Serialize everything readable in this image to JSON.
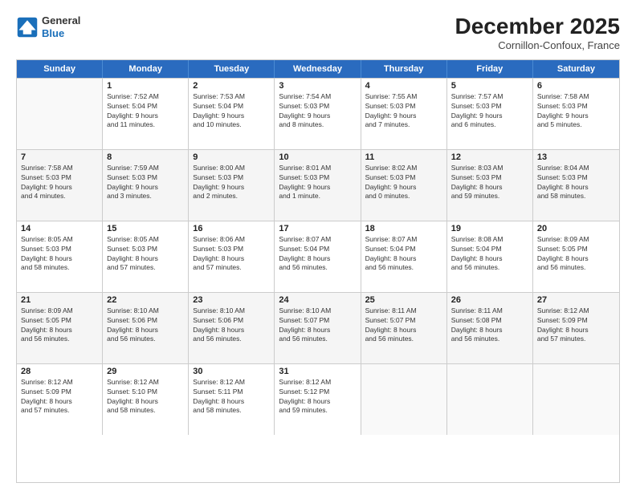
{
  "logo": {
    "line1": "General",
    "line2": "Blue"
  },
  "title": "December 2025",
  "location": "Cornillon-Confoux, France",
  "header_days": [
    "Sunday",
    "Monday",
    "Tuesday",
    "Wednesday",
    "Thursday",
    "Friday",
    "Saturday"
  ],
  "weeks": [
    [
      {
        "day": "",
        "info": ""
      },
      {
        "day": "1",
        "info": "Sunrise: 7:52 AM\nSunset: 5:04 PM\nDaylight: 9 hours\nand 11 minutes."
      },
      {
        "day": "2",
        "info": "Sunrise: 7:53 AM\nSunset: 5:04 PM\nDaylight: 9 hours\nand 10 minutes."
      },
      {
        "day": "3",
        "info": "Sunrise: 7:54 AM\nSunset: 5:03 PM\nDaylight: 9 hours\nand 8 minutes."
      },
      {
        "day": "4",
        "info": "Sunrise: 7:55 AM\nSunset: 5:03 PM\nDaylight: 9 hours\nand 7 minutes."
      },
      {
        "day": "5",
        "info": "Sunrise: 7:57 AM\nSunset: 5:03 PM\nDaylight: 9 hours\nand 6 minutes."
      },
      {
        "day": "6",
        "info": "Sunrise: 7:58 AM\nSunset: 5:03 PM\nDaylight: 9 hours\nand 5 minutes."
      }
    ],
    [
      {
        "day": "7",
        "info": "Sunrise: 7:58 AM\nSunset: 5:03 PM\nDaylight: 9 hours\nand 4 minutes."
      },
      {
        "day": "8",
        "info": "Sunrise: 7:59 AM\nSunset: 5:03 PM\nDaylight: 9 hours\nand 3 minutes."
      },
      {
        "day": "9",
        "info": "Sunrise: 8:00 AM\nSunset: 5:03 PM\nDaylight: 9 hours\nand 2 minutes."
      },
      {
        "day": "10",
        "info": "Sunrise: 8:01 AM\nSunset: 5:03 PM\nDaylight: 9 hours\nand 1 minute."
      },
      {
        "day": "11",
        "info": "Sunrise: 8:02 AM\nSunset: 5:03 PM\nDaylight: 9 hours\nand 0 minutes."
      },
      {
        "day": "12",
        "info": "Sunrise: 8:03 AM\nSunset: 5:03 PM\nDaylight: 8 hours\nand 59 minutes."
      },
      {
        "day": "13",
        "info": "Sunrise: 8:04 AM\nSunset: 5:03 PM\nDaylight: 8 hours\nand 58 minutes."
      }
    ],
    [
      {
        "day": "14",
        "info": "Sunrise: 8:05 AM\nSunset: 5:03 PM\nDaylight: 8 hours\nand 58 minutes."
      },
      {
        "day": "15",
        "info": "Sunrise: 8:05 AM\nSunset: 5:03 PM\nDaylight: 8 hours\nand 57 minutes."
      },
      {
        "day": "16",
        "info": "Sunrise: 8:06 AM\nSunset: 5:03 PM\nDaylight: 8 hours\nand 57 minutes."
      },
      {
        "day": "17",
        "info": "Sunrise: 8:07 AM\nSunset: 5:04 PM\nDaylight: 8 hours\nand 56 minutes."
      },
      {
        "day": "18",
        "info": "Sunrise: 8:07 AM\nSunset: 5:04 PM\nDaylight: 8 hours\nand 56 minutes."
      },
      {
        "day": "19",
        "info": "Sunrise: 8:08 AM\nSunset: 5:04 PM\nDaylight: 8 hours\nand 56 minutes."
      },
      {
        "day": "20",
        "info": "Sunrise: 8:09 AM\nSunset: 5:05 PM\nDaylight: 8 hours\nand 56 minutes."
      }
    ],
    [
      {
        "day": "21",
        "info": "Sunrise: 8:09 AM\nSunset: 5:05 PM\nDaylight: 8 hours\nand 56 minutes."
      },
      {
        "day": "22",
        "info": "Sunrise: 8:10 AM\nSunset: 5:06 PM\nDaylight: 8 hours\nand 56 minutes."
      },
      {
        "day": "23",
        "info": "Sunrise: 8:10 AM\nSunset: 5:06 PM\nDaylight: 8 hours\nand 56 minutes."
      },
      {
        "day": "24",
        "info": "Sunrise: 8:10 AM\nSunset: 5:07 PM\nDaylight: 8 hours\nand 56 minutes."
      },
      {
        "day": "25",
        "info": "Sunrise: 8:11 AM\nSunset: 5:07 PM\nDaylight: 8 hours\nand 56 minutes."
      },
      {
        "day": "26",
        "info": "Sunrise: 8:11 AM\nSunset: 5:08 PM\nDaylight: 8 hours\nand 56 minutes."
      },
      {
        "day": "27",
        "info": "Sunrise: 8:12 AM\nSunset: 5:09 PM\nDaylight: 8 hours\nand 57 minutes."
      }
    ],
    [
      {
        "day": "28",
        "info": "Sunrise: 8:12 AM\nSunset: 5:09 PM\nDaylight: 8 hours\nand 57 minutes."
      },
      {
        "day": "29",
        "info": "Sunrise: 8:12 AM\nSunset: 5:10 PM\nDaylight: 8 hours\nand 58 minutes."
      },
      {
        "day": "30",
        "info": "Sunrise: 8:12 AM\nSunset: 5:11 PM\nDaylight: 8 hours\nand 58 minutes."
      },
      {
        "day": "31",
        "info": "Sunrise: 8:12 AM\nSunset: 5:12 PM\nDaylight: 8 hours\nand 59 minutes."
      },
      {
        "day": "",
        "info": ""
      },
      {
        "day": "",
        "info": ""
      },
      {
        "day": "",
        "info": ""
      }
    ]
  ]
}
